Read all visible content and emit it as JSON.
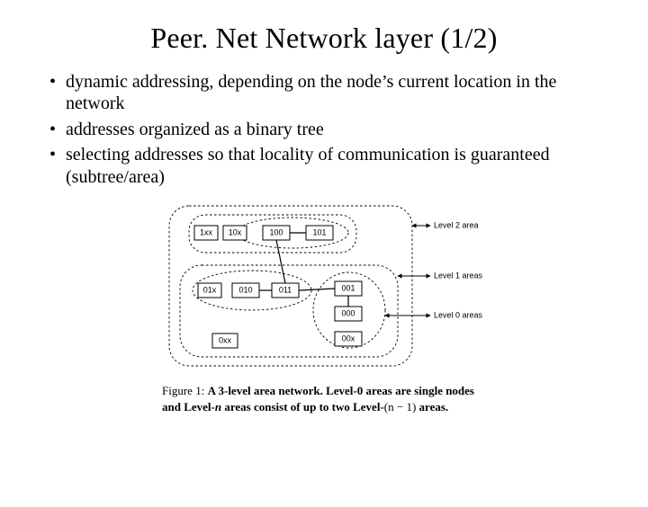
{
  "title": "Peer. Net Network layer (1/2)",
  "bullets": [
    "dynamic addressing, depending on the node’s current location in the network",
    "addresses organized as a binary tree",
    "selecting addresses so that locality of communication is guaranteed (subtree/area)"
  ],
  "figure": {
    "nodes": {
      "n100": "100",
      "n101": "101",
      "n010": "010",
      "n011": "011",
      "n001": "001",
      "n000": "000"
    },
    "area_labels": {
      "l1xx": "1xx",
      "l10x": "10x",
      "l01x": "01x",
      "l0xx": "0xx",
      "l00x": "00x"
    },
    "annotations": {
      "level2": "Level 2 area",
      "level1": "Level 1 areas",
      "level0": "Level 0 areas"
    }
  },
  "caption": {
    "prefix": "Figure 1: ",
    "bold1": "A 3-level area network. Level-0 areas are single nodes and Level-",
    "italic_n": "n",
    "bold2": " areas consist of up to two Level-",
    "expr": "(n − 1)",
    "bold3": " areas."
  }
}
